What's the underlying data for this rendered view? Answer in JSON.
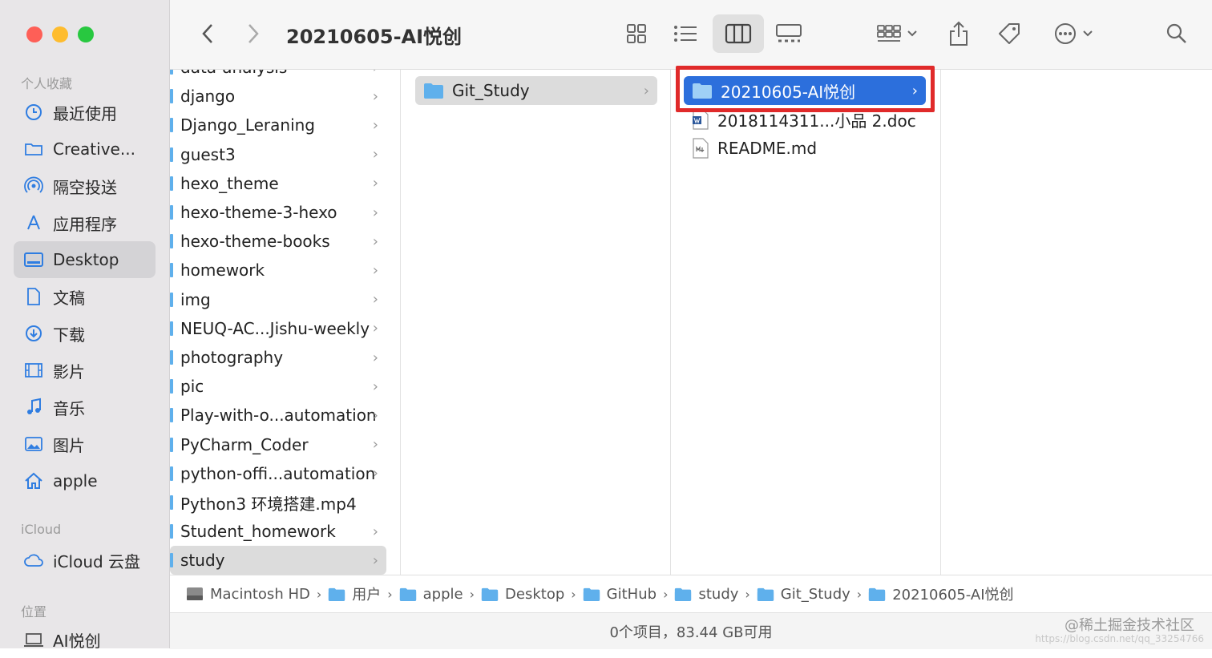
{
  "window": {
    "title": "20210605-AI悦创"
  },
  "sidebar": {
    "favorites_header": "个人收藏",
    "items": [
      {
        "label": "最近使用",
        "icon": "clock-icon"
      },
      {
        "label": "Creative...",
        "icon": "folder-icon"
      },
      {
        "label": "隔空投送",
        "icon": "airdrop-icon"
      },
      {
        "label": "应用程序",
        "icon": "applications-icon"
      },
      {
        "label": "Desktop",
        "icon": "desktop-icon",
        "selected": true
      },
      {
        "label": "文稿",
        "icon": "document-icon"
      },
      {
        "label": "下载",
        "icon": "download-icon"
      },
      {
        "label": "影片",
        "icon": "film-icon"
      },
      {
        "label": "音乐",
        "icon": "music-icon"
      },
      {
        "label": "图片",
        "icon": "photo-icon"
      },
      {
        "label": "apple",
        "icon": "home-icon"
      }
    ],
    "icloud_header": "iCloud",
    "icloud_items": [
      {
        "label": "iCloud 云盘",
        "icon": "cloud-icon"
      }
    ],
    "locations_header": "位置",
    "locations_items": [
      {
        "label": "AI悦创",
        "icon": "laptop-icon"
      }
    ]
  },
  "columns": {
    "col1": [
      {
        "name": "data-analysis",
        "chevron": true
      },
      {
        "name": "django",
        "chevron": true
      },
      {
        "name": "Django_Leraning",
        "chevron": true
      },
      {
        "name": "guest3",
        "chevron": true
      },
      {
        "name": "hexo_theme",
        "chevron": true
      },
      {
        "name": "hexo-theme-3-hexo",
        "chevron": true
      },
      {
        "name": "hexo-theme-books",
        "chevron": true
      },
      {
        "name": "homework",
        "chevron": true
      },
      {
        "name": "img",
        "chevron": true
      },
      {
        "name": "NEUQ-AC...Jishu-weekly",
        "chevron": true
      },
      {
        "name": "photography",
        "chevron": true
      },
      {
        "name": "pic",
        "chevron": true
      },
      {
        "name": "Play-with-o...automation",
        "chevron": true
      },
      {
        "name": "PyCharm_Coder",
        "chevron": true
      },
      {
        "name": "python-offi...automation",
        "chevron": true
      },
      {
        "name": "Python3 环境搭建.mp4",
        "chevron": false
      },
      {
        "name": "Student_homework",
        "chevron": true
      },
      {
        "name": "study",
        "chevron": true,
        "selected": true
      }
    ],
    "col2": [
      {
        "name": "Git_Study",
        "chevron": true,
        "selected": true
      }
    ],
    "col3": [
      {
        "name": "20210605-AI悦创",
        "chevron": true,
        "selected": true,
        "icon": "folder-icon"
      },
      {
        "name": "2018114311...小品 2.doc",
        "chevron": false,
        "icon": "word-doc-icon"
      },
      {
        "name": "README.md",
        "chevron": false,
        "icon": "markdown-file-icon"
      }
    ]
  },
  "path_bar": [
    {
      "label": "Macintosh HD",
      "icon": "harddisk-icon"
    },
    {
      "label": "用户",
      "icon": "folder-icon"
    },
    {
      "label": "apple",
      "icon": "home-folder-icon"
    },
    {
      "label": "Desktop",
      "icon": "folder-icon"
    },
    {
      "label": "GitHub",
      "icon": "folder-icon"
    },
    {
      "label": "study",
      "icon": "folder-icon"
    },
    {
      "label": "Git_Study",
      "icon": "folder-icon"
    },
    {
      "label": "20210605-AI悦创",
      "icon": "folder-icon"
    }
  ],
  "status": "0个项目，83.44 GB可用",
  "watermark": "@稀土掘金技术社区",
  "watermark2": "https://blog.csdn.net/qq_33254766",
  "colors": {
    "accent": "#2c6fdc",
    "highlight": "#e02a2a",
    "folder": "#5fb0ec"
  }
}
